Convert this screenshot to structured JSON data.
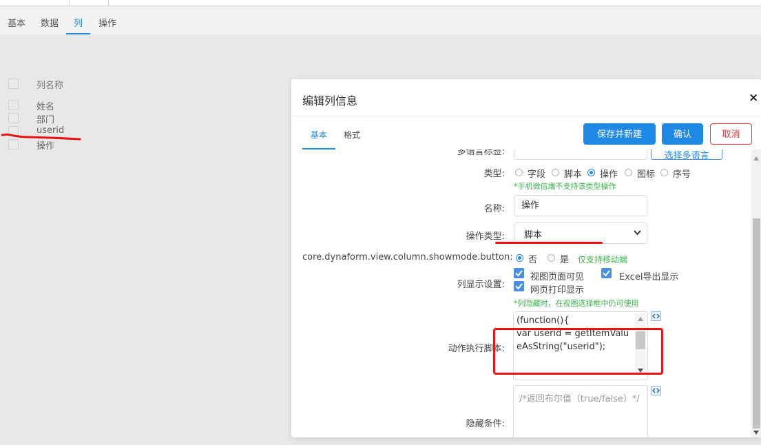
{
  "page_tabs": [
    "基本",
    "数据",
    "列",
    "操作"
  ],
  "column_list": {
    "header": "列名称",
    "items": [
      "姓名",
      "部门",
      "userid",
      "操作"
    ]
  },
  "dialog": {
    "title": "编辑列信息",
    "close_icon": "×",
    "tabs": [
      "基本",
      "格式"
    ],
    "buttons": {
      "save_new": "保存并新建",
      "confirm": "确认",
      "cancel": "取消"
    },
    "partial_label": "多语言标签:",
    "partial_button": "选择多语言",
    "type": {
      "label": "类型:",
      "options": [
        "字段",
        "脚本",
        "操作",
        "图标",
        "序号"
      ],
      "selected": "操作",
      "note": "*手机微信端不支持该类型操作"
    },
    "name": {
      "label": "名称:",
      "value": "操作"
    },
    "action_type": {
      "label": "操作类型:",
      "value": "脚本"
    },
    "showmode": {
      "label": "core.dynaform.view.column.showmode.button:",
      "options": [
        "否",
        "是"
      ],
      "selected": "否",
      "note": "仅支持移动端"
    },
    "display": {
      "label": "列显示设置:",
      "options": [
        "视图页面可见",
        "Excel导出显示",
        "网页打印显示"
      ],
      "note": "*列隐藏时，在视图选择框中仍可使用"
    },
    "action_script": {
      "label": "动作执行脚本:",
      "value": "(function(){\nvar userid = getItemValueAsString(\"userid\");"
    },
    "hide_condition": {
      "label": "隐藏条件:",
      "placeholder": "/*返回布尔值（true/false）*/"
    }
  },
  "colors": {
    "accent": "#1e88e5",
    "danger": "#e53935",
    "note_green": "#39b54a",
    "annotation_red": "#ee1111"
  }
}
